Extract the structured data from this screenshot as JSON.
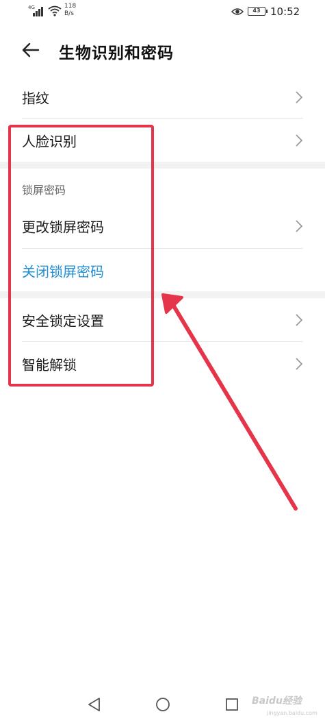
{
  "status_bar": {
    "network": "4G",
    "speed_value": "118",
    "speed_unit": "B/s",
    "battery": "43",
    "time": "10:52"
  },
  "header": {
    "title": "生物识别和密码"
  },
  "rows": {
    "fingerprint": "指纹",
    "face_recognition": "人脸识别",
    "change_lock_password": "更改锁屏密码",
    "disable_lock_password": "关闭锁屏密码",
    "security_lock_settings": "安全锁定设置",
    "smart_unlock": "智能解锁"
  },
  "sections": {
    "lock_screen_password": "锁屏密码"
  },
  "icons": {
    "back": "back-arrow-icon",
    "chevron": "chevron-right-icon",
    "nav_back": "triangle-back-icon",
    "nav_home": "circle-home-icon",
    "nav_recents": "square-recents-icon"
  },
  "colors": {
    "accent_link": "#1f8fd6",
    "annotation": "#e5354a",
    "divider": "#e6e6e6"
  },
  "watermark": {
    "text": "Baidu经验",
    "sub": "jingyan.baidu.com"
  }
}
